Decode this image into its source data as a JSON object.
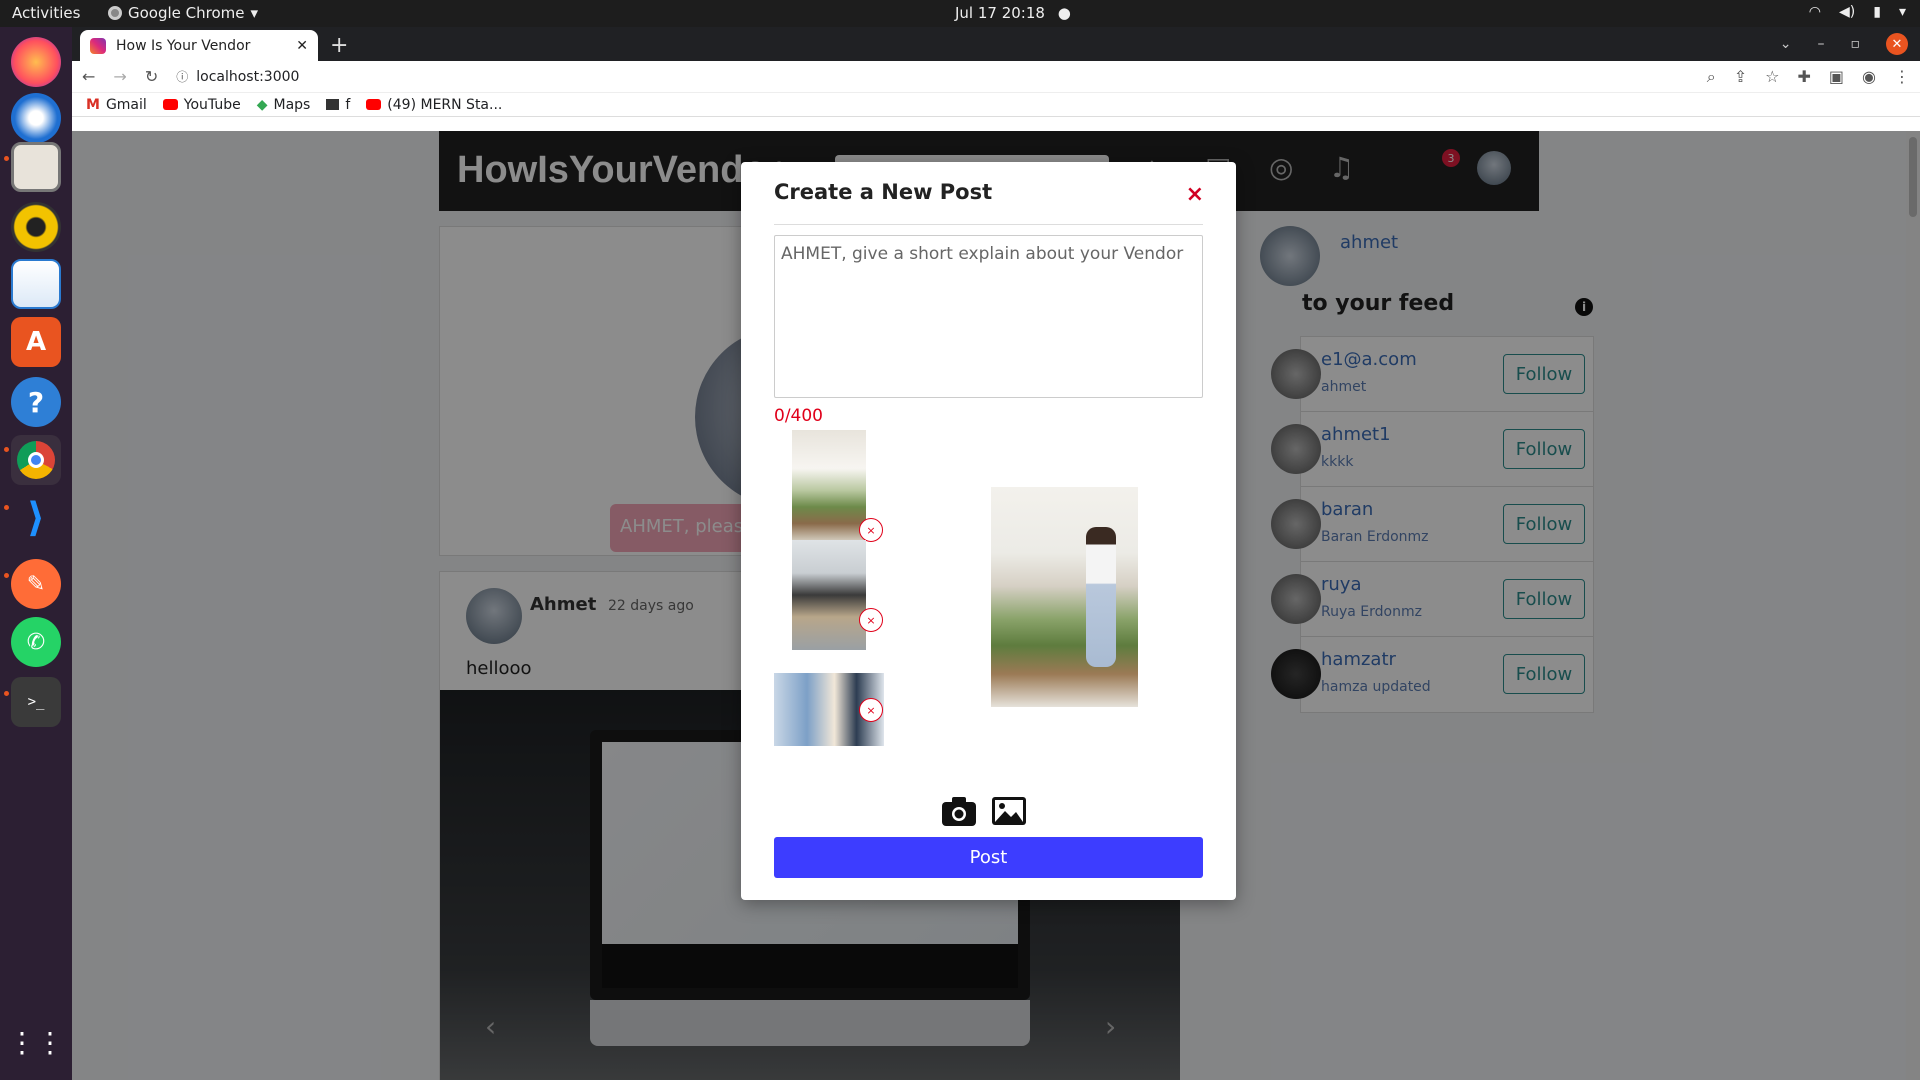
{
  "os": {
    "activities": "Activities",
    "app_name": "Google Chrome",
    "clock": "Jul 17  20:18"
  },
  "browser": {
    "tab_title": "How Is Your Vendor",
    "url": "localhost:3000",
    "bookmarks": [
      "Gmail",
      "YouTube",
      "Maps",
      "f",
      "(49) MERN Sta..."
    ]
  },
  "page": {
    "brand": "HowIsYourVendor",
    "notification_count": "3",
    "profile_prompt": "AHMET, please",
    "post": {
      "author": "Ahmet",
      "time": "22 days ago",
      "text": "hellooo"
    },
    "sidebar": {
      "current_user": "ahmet",
      "heading": "to your feed",
      "follow_label": "Follow",
      "suggestions": [
        {
          "name": "e1@a.com",
          "sub": "ahmet"
        },
        {
          "name": "ahmet1",
          "sub": "kkkk"
        },
        {
          "name": "baran",
          "sub": "Baran Erdonmz"
        },
        {
          "name": "ruya",
          "sub": "Ruya Erdonmz"
        },
        {
          "name": "hamzatr",
          "sub": "hamza updated"
        }
      ]
    }
  },
  "modal": {
    "title": "Create a New Post",
    "close": "×",
    "placeholder": "AHMET, give a short explain about your Vendor",
    "char_count": "0/400",
    "remove_symbol": "×",
    "submit_label": "Post"
  }
}
